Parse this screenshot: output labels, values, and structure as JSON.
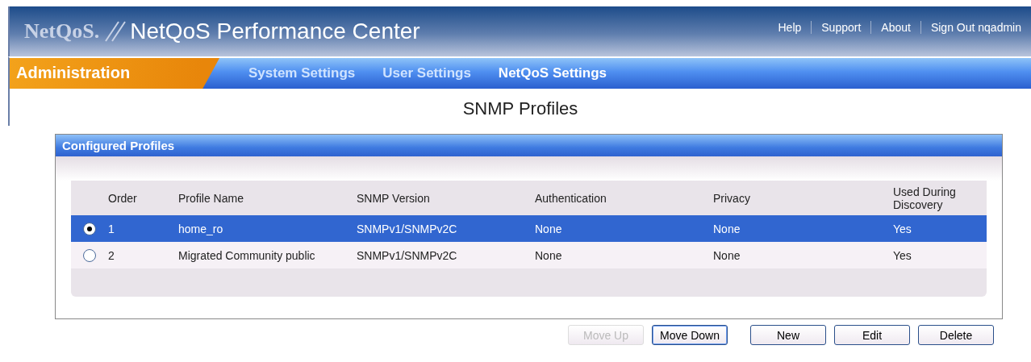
{
  "header": {
    "logo": "NetQoS.",
    "product": "NetQoS Performance Center",
    "links": [
      "Help",
      "Support",
      "About",
      "Sign Out nqadmin"
    ]
  },
  "nav": {
    "section": "Administration",
    "tabs": [
      {
        "label": "System Settings",
        "selected": false
      },
      {
        "label": "User Settings",
        "selected": false
      },
      {
        "label": "NetQoS Settings",
        "selected": true
      }
    ]
  },
  "page_title": "SNMP Profiles",
  "panel": {
    "title": "Configured Profiles",
    "table": {
      "columns": [
        "Order",
        "Profile Name",
        "SNMP Version",
        "Authentication",
        "Privacy",
        "Used During Discovery"
      ],
      "rows": [
        {
          "selected": true,
          "cells": [
            "1",
            "home_ro",
            "SNMPv1/SNMPv2C",
            "None",
            "None",
            "Yes"
          ]
        },
        {
          "selected": false,
          "cells": [
            "2",
            "Migrated Community public",
            "SNMPv1/SNMPv2C",
            "None",
            "None",
            "Yes"
          ]
        }
      ]
    }
  },
  "buttons": [
    {
      "label": "Move Up",
      "disabled": true,
      "focused": false
    },
    {
      "label": "Move Down",
      "disabled": false,
      "focused": true
    },
    {
      "label": "New",
      "disabled": false,
      "focused": false
    },
    {
      "label": "Edit",
      "disabled": false,
      "focused": false
    },
    {
      "label": "Delete",
      "disabled": false,
      "focused": false
    }
  ]
}
